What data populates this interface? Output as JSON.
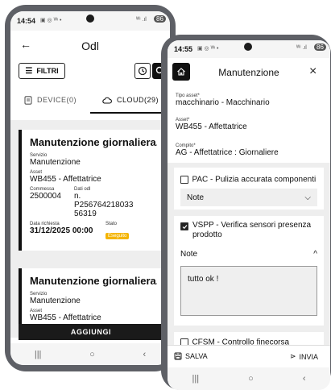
{
  "phone_list": {
    "status_bar": {
      "time": "14:54",
      "battery": "86"
    },
    "title": "Odl",
    "filters_label": "FILTRI",
    "tabs": [
      {
        "label": "DEVICE(0)",
        "icon": "device-icon"
      },
      {
        "label": "CLOUD(29)",
        "icon": "cloud-icon"
      }
    ],
    "cards": [
      {
        "title": "Manutenzione giornaliera...",
        "servizio_label": "Servizio",
        "servizio": "Manutenzione",
        "asset_label": "Asset",
        "asset": "WB455 - Affettatrice",
        "commessa_label": "Commessa",
        "commessa": "2500004",
        "dati_odl_label": "Dati odl",
        "dati_odl_1": "n.",
        "dati_odl_2": "P256764218033",
        "dati_odl_3": "56319",
        "data_richiesta_label": "Data richiesta",
        "data_richiesta": "31/12/2025 00:00",
        "stato_label": "Stato",
        "stato": "Eseguito"
      },
      {
        "title": "Manutenzione giornaliera...",
        "servizio_label": "Servizio",
        "servizio": "Manutenzione",
        "asset_label": "Asset",
        "asset": "WB455 - Affettatrice"
      }
    ],
    "add_button": "AGGIUNGI"
  },
  "phone_detail": {
    "status_bar": {
      "time": "14:55",
      "battery": "86"
    },
    "title": "Manutenzione",
    "fields": [
      {
        "label": "Tipo asset*",
        "value": "macchinario - Macchinario"
      },
      {
        "label": "Asset*",
        "value": "WB455 - Affettatrice"
      },
      {
        "label": "Compito*",
        "value": "AG - Affettatrice : Giornaliere"
      }
    ],
    "checklist": [
      {
        "label": "PAC - Pulizia accurata componenti",
        "checked": false,
        "note_label": "Note"
      },
      {
        "label": "VSPP - Verifica sensori presenza prodotto",
        "checked": true,
        "note_label": "Note",
        "note_value": "tutto ok !"
      },
      {
        "label": "CFSM - Controllo finecorsa sicurezza",
        "checked": false
      }
    ],
    "save_label": "SALVA",
    "send_label": "INVIA"
  },
  "colors": {
    "status_badge": "#f4b400",
    "accent_dark": "#111111"
  }
}
